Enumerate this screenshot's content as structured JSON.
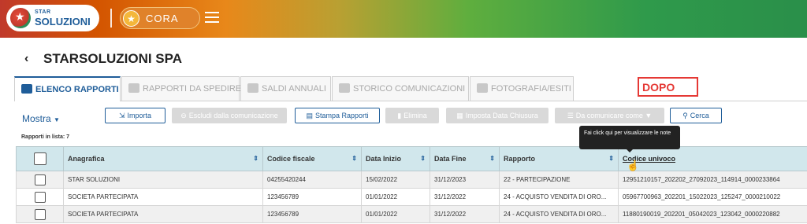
{
  "brand": {
    "logo_small": "STAR",
    "logo_big": "SOLUZIONI",
    "app_name": "CORA"
  },
  "page": {
    "title": "STARSOLUZIONI SPA"
  },
  "tabs": [
    {
      "label": "ELENCO RAPPORTI",
      "active": true
    },
    {
      "label": "RAPPORTI DA SPEDIRE",
      "active": false
    },
    {
      "label": "SALDI ANNUALI",
      "active": false
    },
    {
      "label": "STORICO COMUNICAZIONI",
      "active": false
    },
    {
      "label": "FOTOGRAFIA/ESITI",
      "active": false
    }
  ],
  "annotation": {
    "label": "DOPO",
    "color": "#e53935"
  },
  "toolbar": {
    "mostra": "Mostra",
    "count": "Rapporti in lista: 7",
    "importa": "Importa",
    "escludi": "Escludi dalla comunicazione",
    "stampa": "Stampa Rapporti",
    "elimina": "Elimina",
    "imposta": "Imposta Data Chiusura",
    "da_comunicare": "Da comunicare come",
    "cerca": "Cerca"
  },
  "tooltip": {
    "text": "Fai click qui per visualizzare le note"
  },
  "table": {
    "headers": {
      "anagrafica": "Anagrafica",
      "codice_fiscale": "Codice fiscale",
      "data_inizio": "Data Inizio",
      "data_fine": "Data Fine",
      "rapporto": "Rapporto",
      "codice_univoco": "Codice univoco"
    },
    "rows": [
      {
        "anagrafica": "STAR SOLUZIONI",
        "codice_fiscale": "04255420244",
        "data_inizio": "15/02/2022",
        "data_fine": "31/12/2023",
        "rapporto": "22 - PARTECIPAZIONE",
        "codice_univoco": "12951210157_202202_27092023_114914_0000233864"
      },
      {
        "anagrafica": "SOCIETA PARTECIPATA",
        "codice_fiscale": "123456789",
        "data_inizio": "01/01/2022",
        "data_fine": "31/12/2022",
        "rapporto": "24 - ACQUISTO VENDITA DI ORO...",
        "codice_univoco": "05967700963_202201_15022023_125247_0000210022"
      },
      {
        "anagrafica": "SOCIETA PARTECIPATA",
        "codice_fiscale": "123456789",
        "data_inizio": "01/01/2022",
        "data_fine": "31/12/2022",
        "rapporto": "24 - ACQUISTO VENDITA DI ORO...",
        "codice_univoco": "11880190019_202201_05042023_123042_0000220882"
      }
    ]
  },
  "colors": {
    "primary": "#1f5d99",
    "header_bg": "#d1e7ec",
    "accent_orange": "#e0822a"
  }
}
